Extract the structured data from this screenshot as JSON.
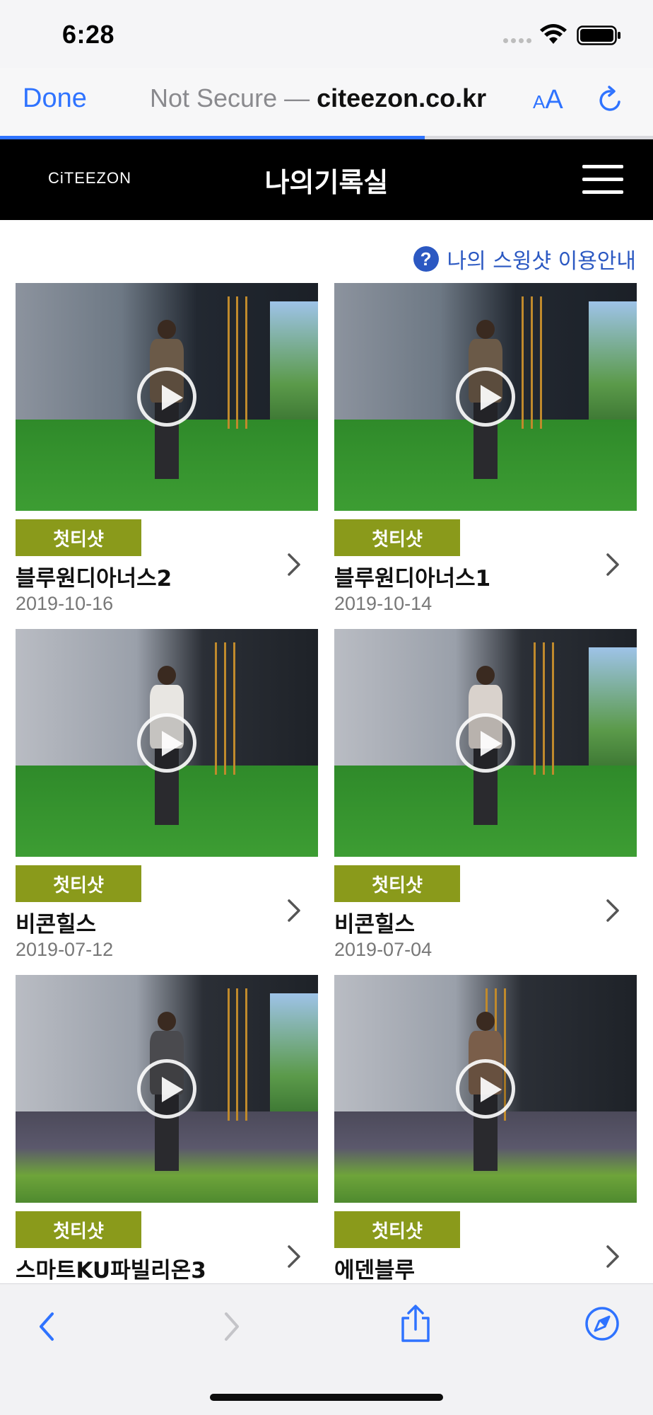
{
  "status_bar": {
    "time": "6:28"
  },
  "browser": {
    "done_label": "Done",
    "url_prefix": "Not Secure —",
    "url_domain": "citeezon.co.kr",
    "text_size_small": "A",
    "text_size_large": "A",
    "load_progress": 0.65
  },
  "header": {
    "logo": "CiTEEZON",
    "title": "나의기록실"
  },
  "guide_link": {
    "icon": "?",
    "label": "나의 스윙샷 이용안내"
  },
  "videos": [
    {
      "badge": "첫티샷",
      "title": "블루원디아너스2",
      "date": "2019-10-16"
    },
    {
      "badge": "첫티샷",
      "title": "블루원디아너스1",
      "date": "2019-10-14"
    },
    {
      "badge": "첫티샷",
      "title": "비콘힐스",
      "date": "2019-07-12"
    },
    {
      "badge": "첫티샷",
      "title": "비콘힐스",
      "date": "2019-07-04"
    },
    {
      "badge": "첫티샷",
      "title": "스마트KU파빌리온3",
      "date": ""
    },
    {
      "badge": "첫티샷",
      "title": "에덴블루",
      "date": ""
    }
  ],
  "colors": {
    "accent_blue": "#2f73ff",
    "guide_blue": "#2b58c2",
    "badge_olive": "#8a9a1b",
    "header_black": "#000000"
  },
  "icons": {
    "back": "chevron-left-icon",
    "forward": "chevron-right-icon",
    "share": "share-icon",
    "bookmarks": "compass-icon"
  }
}
